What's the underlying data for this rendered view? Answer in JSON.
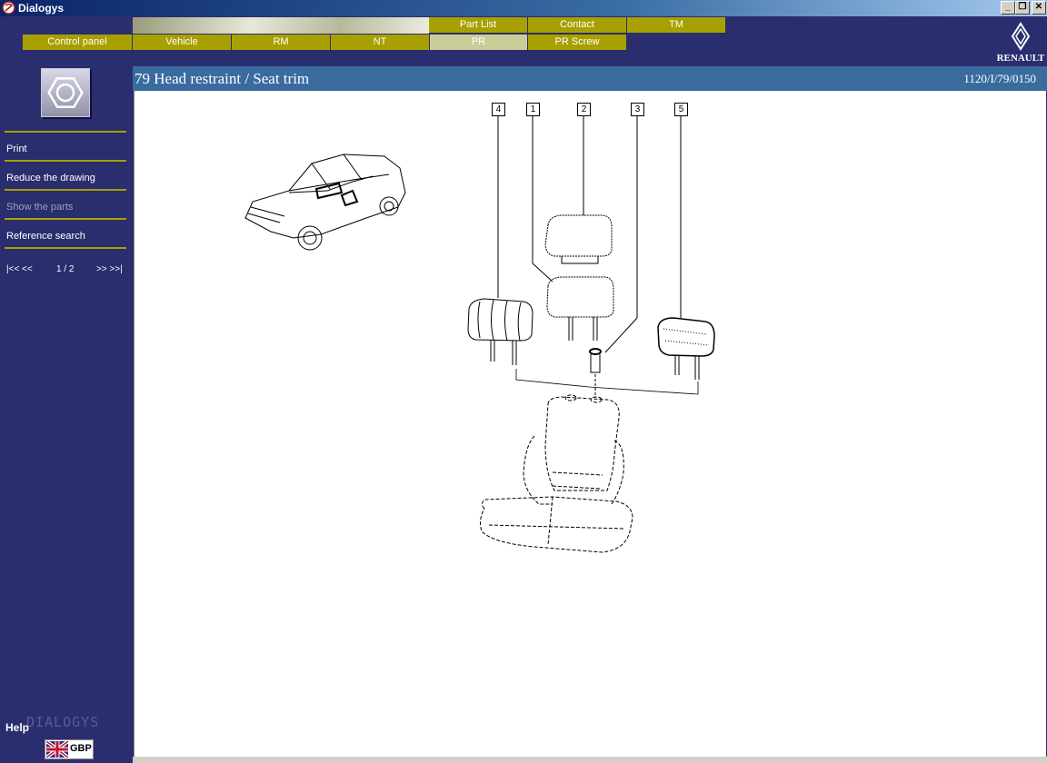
{
  "window": {
    "title": "Dialogys",
    "min": "_",
    "max": "❐",
    "close": "✕"
  },
  "nav": {
    "top_tabs": [
      "Part List",
      "Contact",
      "TM"
    ],
    "bottom_tabs": [
      "Control panel",
      "Vehicle",
      "RM",
      "NT",
      "PR",
      "PR Screw"
    ],
    "active_tab": "PR"
  },
  "brand": {
    "name": "RENAULT"
  },
  "sidebar": {
    "menu": [
      {
        "label": "Print",
        "enabled": true
      },
      {
        "label": "Reduce the drawing",
        "enabled": true
      },
      {
        "label": "Show the parts",
        "enabled": false
      },
      {
        "label": "Reference search",
        "enabled": true
      }
    ],
    "pager": {
      "first_prev": "|<< <<",
      "page": "1 / 2",
      "next_last": ">> >>|"
    },
    "help": "Help",
    "watermark": "DIALOGYS",
    "currency": "GBP"
  },
  "page": {
    "title": "79 Head restraint / Seat trim",
    "reference": "1120/I/79/0150"
  },
  "drawing": {
    "callouts": [
      "4",
      "1",
      "2",
      "3",
      "5"
    ]
  },
  "colors": {
    "nav_bg": "#2a2d6e",
    "tab": "#a8a000",
    "tab_active": "#cccc99",
    "header": "#3a6b9e"
  }
}
